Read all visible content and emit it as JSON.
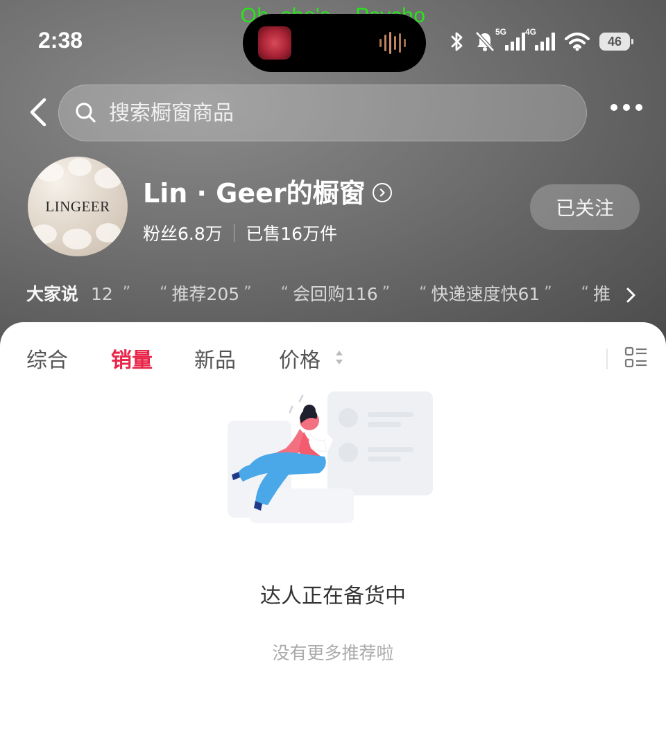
{
  "status_bar": {
    "lyric": "Oh, she's... Psycho",
    "time": "2:38",
    "signal1_label": "5G",
    "signal2_label": "4G",
    "battery": "46"
  },
  "header": {
    "search_placeholder": "搜索橱窗商品",
    "shop_name": "Lin · Geer的橱窗",
    "avatar_logo_text": "LINGEER",
    "fans": "粉丝6.8万",
    "sold": "已售16万件",
    "follow_label": "已关注"
  },
  "reviews": {
    "lead": "大家说",
    "lead_count": "12",
    "tags": [
      "推荐205",
      "会回购116",
      "快递速度快61",
      "推"
    ]
  },
  "tabs": [
    {
      "label": "综合"
    },
    {
      "label": "销量",
      "active": true
    },
    {
      "label": "新品"
    },
    {
      "label": "价格"
    }
  ],
  "empty_state": {
    "title": "达人正在备货中",
    "subtitle": "没有更多推荐啦"
  },
  "colors": {
    "accent": "#e8264a",
    "lyric": "#27e61a"
  }
}
